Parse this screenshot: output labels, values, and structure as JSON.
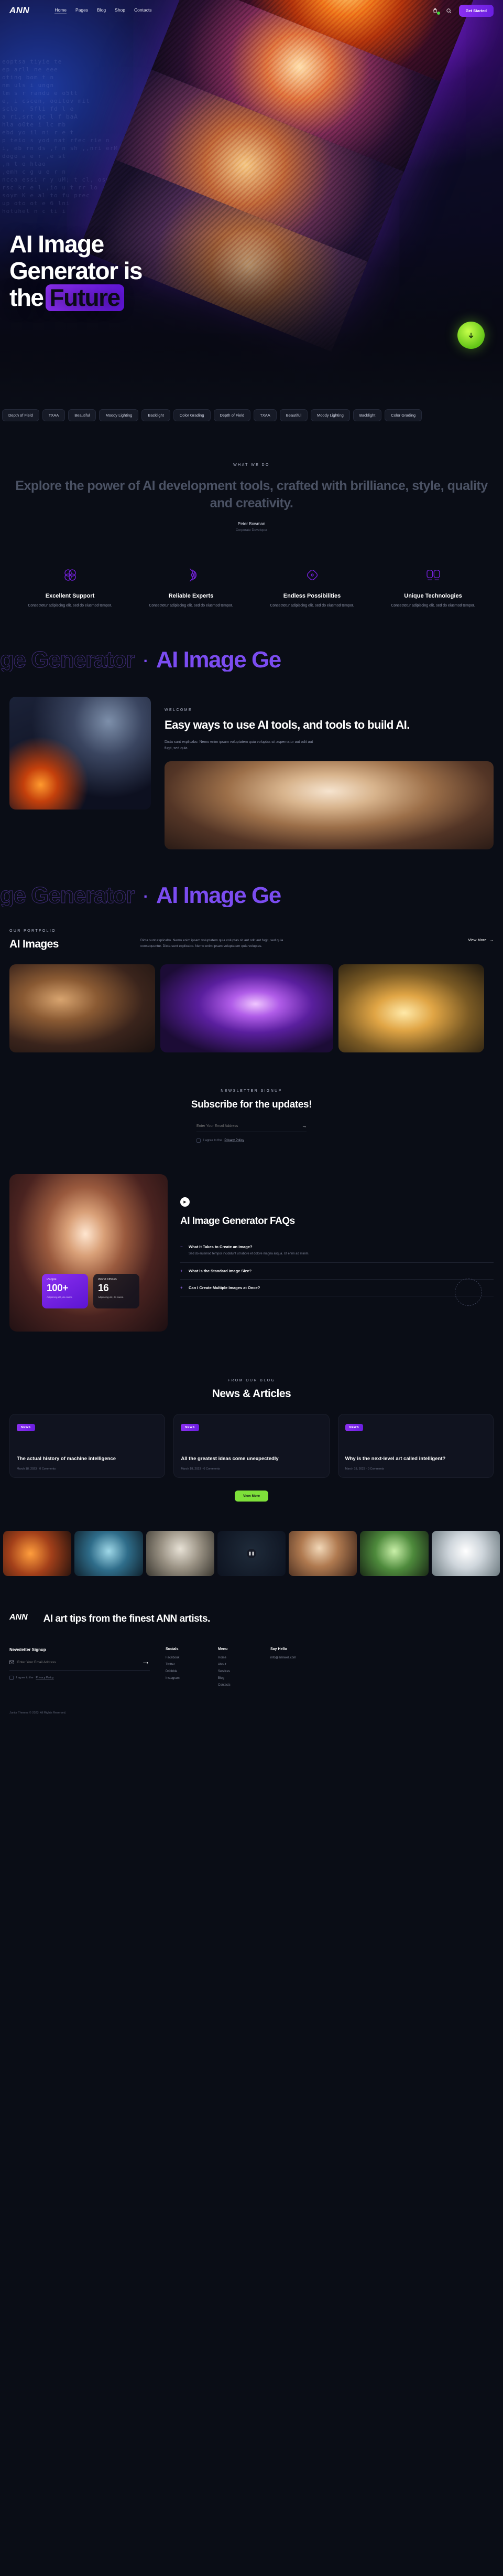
{
  "brand": {
    "name": "ANN"
  },
  "header": {
    "nav": [
      {
        "label": "Home",
        "active": true
      },
      {
        "label": "Pages",
        "active": false
      },
      {
        "label": "Blog",
        "active": false
      },
      {
        "label": "Shop",
        "active": false
      },
      {
        "label": "Contacts",
        "active": false
      }
    ],
    "cart_icon": "shopping-bag-icon",
    "search_icon": "search-icon",
    "cta_label": "Get Started"
  },
  "hero": {
    "line1": "AI Image",
    "line2": "Generator is",
    "line3_pre": "the",
    "line3_highlight": "Future",
    "badge_icon": "arrow-down-icon",
    "bg_text": "eoptsa tiyie te\nep arll ne eee\noting bom t n\nnm uls i ungn\nlm s r randu e o5tt\ne, i cscen, ooitov mit\nsclo , 5fli fd l e\na ri,srt gc l f baA\nhla o0te i lc mb\nebd yo il ni r e t\np teio s yod nat rfec rie n\ni, eb rn ds ,f n sh ,,nri erM\ndogo a e r ,e st\n,n t o htao\n,emh c g u e r n\nncca essi r y uM; t cl, osy c t Seg\nrsc kr e l ,io u t rr lo\nsoym K e al to fu prec\nup oto ot e 6 lni\nhotuhel n c ti i"
  },
  "tags": [
    "Depth of Field",
    "TXAA",
    "Beautiful",
    "Moody Lighting",
    "Backlight",
    "Color Grading",
    "Depth of Field",
    "TXAA",
    "Beautiful",
    "Moody Lighting",
    "Backlight",
    "Color Grading"
  ],
  "what_we_do": {
    "eyebrow": "WHAT WE DO",
    "quote": "Explore the power of AI development tools, crafted with brilliance, style, quality and creativity.",
    "author": "Peter Bowman",
    "role": "Corporate Developer"
  },
  "features": [
    {
      "icon": "four-circles-icon",
      "title": "Excellent Support",
      "text": "Consectetur adipiscing elit, sed do eiusmod tempor."
    },
    {
      "icon": "radar-waves-icon",
      "title": "Reliable Experts",
      "text": "Consectetur adipiscing elit, sed do eiusmod tempor."
    },
    {
      "icon": "diamond-icon",
      "title": "Endless Possibilities",
      "text": "Consectetur adipiscing elit, sed do eiusmod tempor."
    },
    {
      "icon": "dual-shapes-icon",
      "title": "Unique Technologies",
      "text": "Consectetur adipiscing elit, sed do eiusmod tempor."
    }
  ],
  "marquee": {
    "outline": "ge Generator",
    "solid": "AI Image Ge",
    "outline2": "ge Generator",
    "solid2": "AI Image Ge"
  },
  "welcome": {
    "eyebrow": "WELCOME",
    "title": "Easy ways to use AI tools, and tools to build AI.",
    "text": "Dicta sunt explicabo. Nemo enim ipsam voluptatem quia voluptas sit aspernatur aut odit aut fugit, sed quia."
  },
  "portfolio": {
    "eyebrow": "OUR PORTFOLIO",
    "title": "AI Images",
    "text": "Dicta sunt explicabo. Nemo enim ipsam voluptatem quia voluptas sit aut odit aut fugit, sed quia consequuntur. Dicta sunt explicabo. Nemo enim ipsam voluptatem quia voluptas.",
    "view_more": "View More"
  },
  "newsletter": {
    "eyebrow": "NEWSLETTER SIGNUP",
    "title": "Subscribe for the updates!",
    "placeholder": "Enter Your Email Address",
    "submit_icon": "arrow-right-icon",
    "agree_pre": "I agree to the",
    "agree_link": "Privacy Policy"
  },
  "faq": {
    "play_icon": "play-icon",
    "title": "AI Image Generator FAQs",
    "stats": [
      {
        "label": "People",
        "value": "100+",
        "sub": "Adipiscing elit, do eiusm."
      },
      {
        "label": "World Offices",
        "value": "16",
        "sub": "Adipiscing elit, do eiusm."
      }
    ],
    "items": [
      {
        "sym": "−",
        "q": "What It Takes to Create an Image?",
        "a": "Sed do eiusmod tempor incididunt ut labore et dolore magna aliqua. Ut enim ad minim."
      },
      {
        "sym": "+",
        "q": "What is the Standard Image Size?",
        "a": ""
      },
      {
        "sym": "+",
        "q": "Can I Create Multiple Images at Once?",
        "a": ""
      }
    ]
  },
  "news": {
    "eyebrow": "FROM OUR BLOG",
    "title": "News & Articles",
    "cards": [
      {
        "badge": "NEWS",
        "title": "The actual history of machine intelligence",
        "meta": "March 18, 2023    ·    0 Comments"
      },
      {
        "badge": "NEWS",
        "title": "All the greatest ideas come unexpectedly",
        "meta": "March 18, 2023    ·    0 Comments"
      },
      {
        "badge": "NEWS",
        "title": "Why is the next-level art called intelligent?",
        "meta": "March 18, 2023    ·    0 Comments"
      }
    ],
    "button": "View More"
  },
  "strip": {
    "pause_icon": "pause-icon"
  },
  "footer": {
    "logo": "ANN",
    "headline": "AI art tips from the finest ANN artists.",
    "newsletter_title": "Newsletter Signup",
    "email_placeholder": "Enter Your Email Address",
    "email_icon": "envelope-icon",
    "submit_icon": "arrow-right-icon",
    "agree_pre": "I agree to the",
    "agree_link": "Privacy Policy",
    "columns": [
      {
        "heading": "Socials",
        "links": [
          "Facebook",
          "Twitter",
          "Dribbble",
          "Instagram"
        ]
      },
      {
        "heading": "Menu",
        "links": [
          "Home",
          "About",
          "Services",
          "Blog",
          "Contacts"
        ]
      },
      {
        "heading": "Say Hello",
        "links": [
          "info@annwell.com"
        ]
      }
    ],
    "copyright": "Junior Themes © 2023. All Rights Reserved."
  }
}
